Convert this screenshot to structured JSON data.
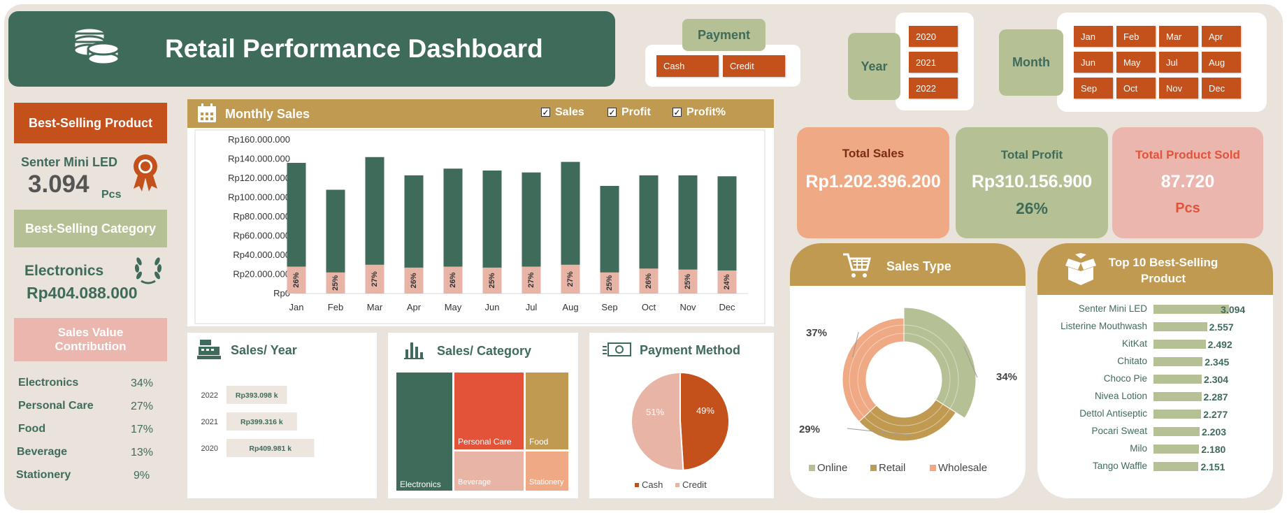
{
  "header": {
    "title": "Retail Performance Dashboard",
    "icon": "coins-stack-icon"
  },
  "slicers": {
    "payment": {
      "label": "Payment",
      "options": [
        "Cash",
        "Credit"
      ]
    },
    "year": {
      "label": "Year",
      "options": [
        "2020",
        "2021",
        "2022"
      ]
    },
    "month": {
      "label": "Month",
      "options": [
        "Jan",
        "Feb",
        "Mar",
        "Apr",
        "Jun",
        "May",
        "Jul",
        "Aug",
        "Sep",
        "Oct",
        "Nov",
        "Dec"
      ]
    }
  },
  "kpis": {
    "total_sales": {
      "label": "Total Sales",
      "value": "Rp1.202.396.200"
    },
    "total_profit": {
      "label": "Total Profit",
      "value": "Rp310.156.900",
      "pct": "26%"
    },
    "total_sold": {
      "label": "Total Product Sold",
      "value": "87.720",
      "unit": "Pcs"
    }
  },
  "best_product": {
    "label": "Best-Selling Product",
    "name": "Senter Mini LED",
    "qty": "3.094",
    "unit": "Pcs",
    "icon": "award-ribbon-icon"
  },
  "best_category": {
    "label": "Best-Selling Category",
    "name": "Electronics",
    "value": "Rp404.088.000",
    "icon": "laurel-wreath-icon"
  },
  "contribution": {
    "label": "Sales Value Contribution",
    "rows": [
      {
        "name": "Electronics",
        "pct": "34%"
      },
      {
        "name": "Personal Care",
        "pct": "27%"
      },
      {
        "name": "Food",
        "pct": "17%"
      },
      {
        "name": "Beverage",
        "pct": "13%"
      },
      {
        "name": "Stationery",
        "pct": "9%"
      }
    ]
  },
  "monthly": {
    "title": "Monthly Sales",
    "icon": "calendar-icon",
    "toggles": [
      {
        "label": "Sales",
        "checked": true
      },
      {
        "label": "Profit",
        "checked": true
      },
      {
        "label": "Profit%",
        "checked": true
      }
    ]
  },
  "sales_year_title": "Sales/ Year",
  "sales_category_title": "Sales/ Category",
  "payment_title": "Payment Method",
  "sales_type_title": "Sales Type",
  "top10_title": "Top 10 Best-Selling Product",
  "colors": {
    "green": "#3f6b5a",
    "sage": "#b5c095",
    "orange": "#c4501b",
    "gold": "#c19a52",
    "peach": "#f0a985",
    "pink": "#e8b4a5",
    "red": "#e2533a"
  },
  "chart_data": [
    {
      "type": "bar",
      "name": "monthly_sales",
      "categories": [
        "Jan",
        "Feb",
        "Mar",
        "Apr",
        "May",
        "Jun",
        "Jul",
        "Aug",
        "Sep",
        "Oct",
        "Nov",
        "Dec"
      ],
      "series": [
        {
          "name": "Sales",
          "values": [
            136000000,
            108000000,
            142000000,
            123000000,
            130000000,
            128000000,
            126000000,
            137000000,
            112000000,
            123000000,
            123000000,
            122000000
          ]
        },
        {
          "name": "Profit",
          "values": [
            28000000,
            22000000,
            30000000,
            27000000,
            28000000,
            27000000,
            28000000,
            30000000,
            22000000,
            26000000,
            25000000,
            24000000
          ]
        }
      ],
      "data_labels": [
        "26%",
        "25%",
        "27%",
        "26%",
        "26%",
        "25%",
        "27%",
        "27%",
        "25%",
        "26%",
        "25%",
        "24%"
      ],
      "yticks": [
        "Rp0",
        "Rp20.000.000",
        "Rp40.000.000",
        "Rp60.000.000",
        "Rp80.000.000",
        "Rp100.000.000",
        "Rp120.000.000",
        "Rp140.000.000",
        "Rp160.000.000"
      ],
      "ylim": [
        0,
        160000000
      ],
      "grid": false
    },
    {
      "type": "bar",
      "name": "sales_per_year",
      "categories": [
        "2022",
        "2021",
        "2020"
      ],
      "values": [
        393098,
        399316,
        409981
      ],
      "data_labels": [
        "Rp393.098 k",
        "Rp399.316 k",
        "Rp409.981 k"
      ]
    },
    {
      "type": "heatmap",
      "name": "sales_per_category_treemap",
      "categories": [
        "Electronics",
        "Personal Care",
        "Food",
        "Beverage",
        "Stationery"
      ],
      "values": [
        34,
        27,
        17,
        13,
        9
      ]
    },
    {
      "type": "pie",
      "name": "payment_method",
      "categories": [
        "Cash",
        "Credit"
      ],
      "values": [
        49,
        51
      ],
      "data_labels": [
        "49%",
        "51%"
      ],
      "legend": "bottom"
    },
    {
      "type": "pie",
      "name": "sales_type",
      "categories": [
        "Online",
        "Retail",
        "Wholesale"
      ],
      "values": [
        34,
        29,
        37
      ],
      "data_labels": [
        "34%",
        "29%",
        "37%"
      ],
      "legend": "bottom"
    },
    {
      "type": "bar",
      "name": "top10_products",
      "categories": [
        "Senter Mini LED",
        "Listerine Mouthwash",
        "KitKat",
        "Chitato",
        "Choco Pie",
        "Nivea Lotion",
        "Dettol Antiseptic",
        "Pocari Sweat",
        "Milo",
        "Tango Waffle"
      ],
      "values": [
        3094,
        2557,
        2492,
        2345,
        2304,
        2287,
        2277,
        2203,
        2180,
        2151
      ],
      "data_labels": [
        "3.094",
        "2.557",
        "2.492",
        "2.345",
        "2.304",
        "2.287",
        "2.277",
        "2.203",
        "2.180",
        "2.151"
      ]
    }
  ]
}
